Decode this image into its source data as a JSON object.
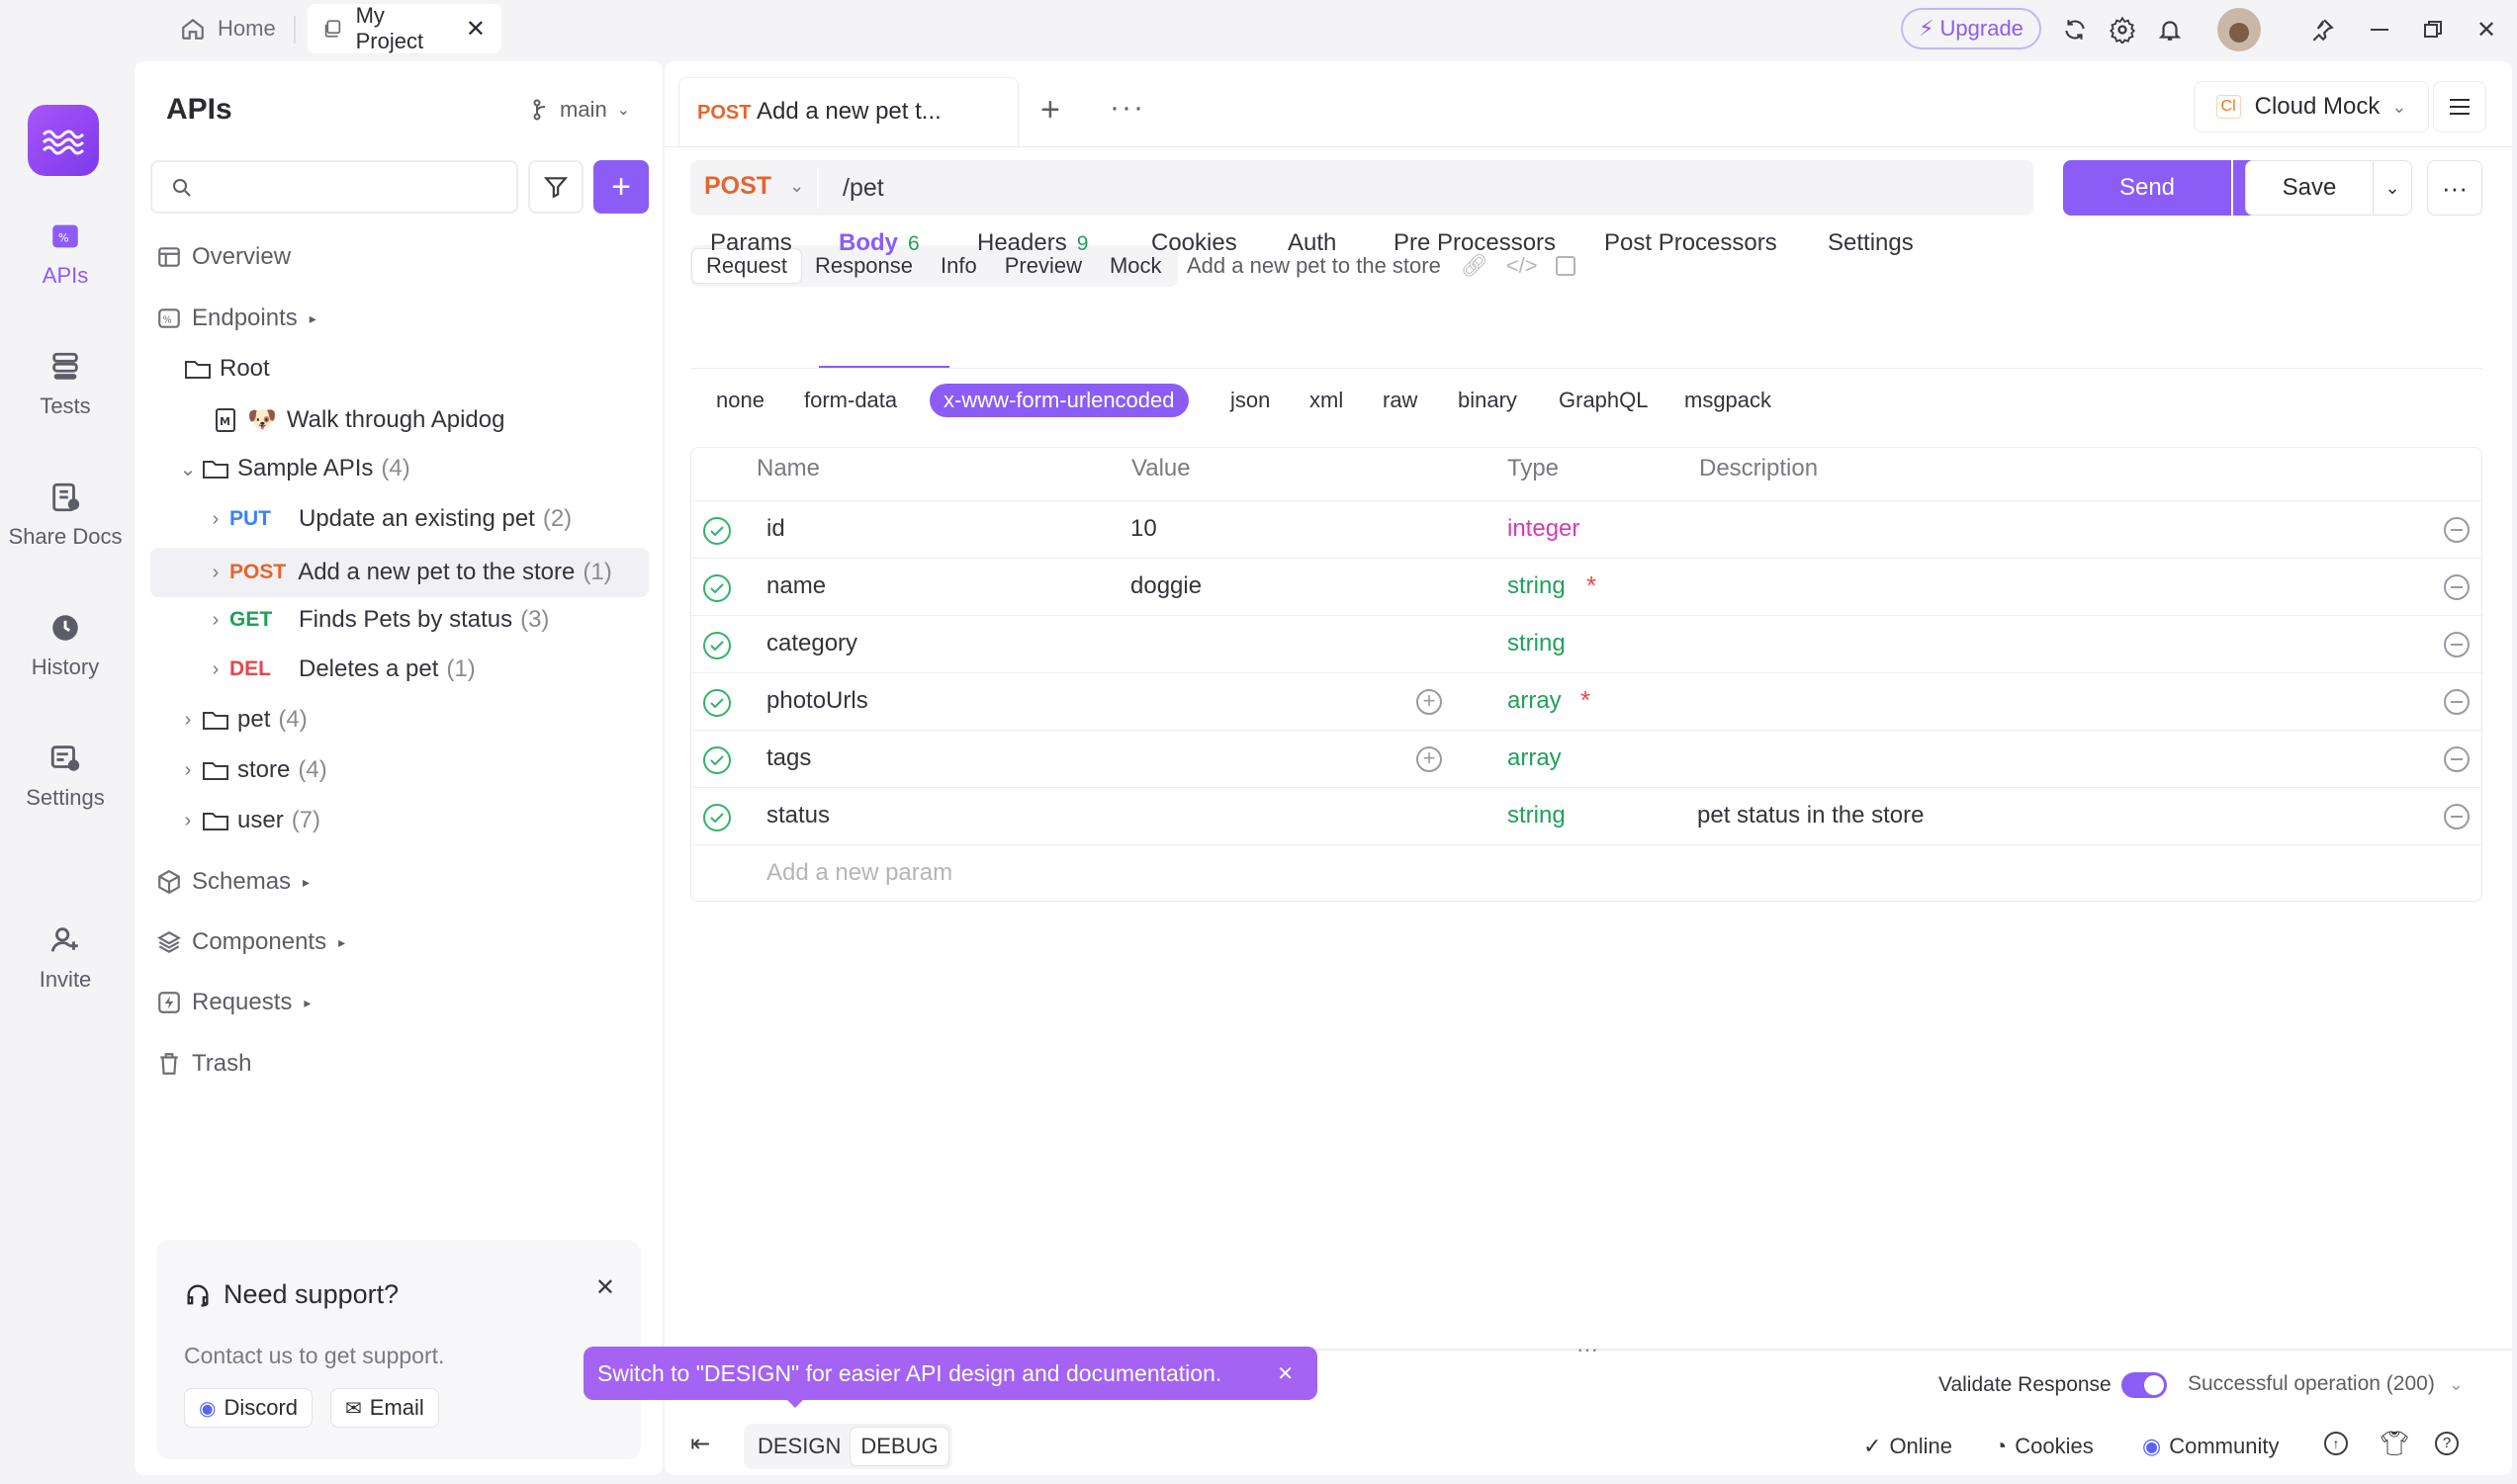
{
  "titlebar": {
    "home_tab": "Home",
    "project_tab": "My Project",
    "upgrade": "Upgrade"
  },
  "rail": {
    "items": [
      {
        "label": "APIs",
        "icon": "apis-icon"
      },
      {
        "label": "Tests",
        "icon": "tests-icon"
      },
      {
        "label": "Share Docs",
        "icon": "share-docs-icon"
      },
      {
        "label": "History",
        "icon": "history-icon"
      },
      {
        "label": "Settings",
        "icon": "settings-icon"
      },
      {
        "label": "Invite",
        "icon": "invite-icon"
      }
    ]
  },
  "leftpanel": {
    "title": "APIs",
    "branch": "main",
    "overview": "Overview",
    "endpoints": "Endpoints",
    "root": "Root",
    "walkthrough": "Walk through Apidog",
    "sample_apis": {
      "label": "Sample APIs",
      "count": "(4)"
    },
    "endpoint_items": [
      {
        "method": "PUT",
        "label": "Update an existing pet",
        "count": "(2)"
      },
      {
        "method": "POST",
        "label": "Add a new pet to the store",
        "count": "(1)"
      },
      {
        "method": "GET",
        "label": "Finds Pets by status",
        "count": "(3)"
      },
      {
        "method": "DEL",
        "label": "Deletes a pet",
        "count": "(1)"
      }
    ],
    "folders": [
      {
        "label": "pet",
        "count": "(4)"
      },
      {
        "label": "store",
        "count": "(4)"
      },
      {
        "label": "user",
        "count": "(7)"
      }
    ],
    "schemas": "Schemas",
    "components": "Components",
    "requests": "Requests",
    "trash": "Trash",
    "support": {
      "title": "Need support?",
      "text": "Contact us to get support.",
      "discord": "Discord",
      "email": "Email"
    }
  },
  "main": {
    "tab": {
      "method": "POST",
      "title": "Add a new pet t..."
    },
    "env": "Cloud Mock",
    "request": {
      "method": "POST",
      "path": "/pet"
    },
    "send": "Send",
    "save": "Save",
    "view_tabs": [
      "Request",
      "Response",
      "Info",
      "Preview",
      "Mock"
    ],
    "endpoint_name": "Add a new pet to the store",
    "sub_tabs": [
      {
        "label": "Params",
        "badge": ""
      },
      {
        "label": "Body",
        "badge": "6"
      },
      {
        "label": "Headers",
        "badge": "9"
      },
      {
        "label": "Cookies",
        "badge": ""
      },
      {
        "label": "Auth",
        "badge": ""
      },
      {
        "label": "Pre Processors",
        "badge": ""
      },
      {
        "label": "Post Processors",
        "badge": ""
      },
      {
        "label": "Settings",
        "badge": ""
      }
    ],
    "body_types": [
      "none",
      "form-data",
      "x-www-form-urlencoded",
      "json",
      "xml",
      "raw",
      "binary",
      "GraphQL",
      "msgpack"
    ],
    "table": {
      "headers": [
        "Name",
        "Value",
        "Type",
        "Description"
      ],
      "rows": [
        {
          "name": "id",
          "value": "10",
          "type": "integer",
          "required": "",
          "description": ""
        },
        {
          "name": "name",
          "value": "doggie",
          "type": "string",
          "required": "*",
          "description": ""
        },
        {
          "name": "category",
          "value": "",
          "type": "string",
          "required": "",
          "description": ""
        },
        {
          "name": "photoUrls",
          "value": "",
          "type": "array",
          "required": "*",
          "description": ""
        },
        {
          "name": "tags",
          "value": "",
          "type": "array",
          "required": "",
          "description": ""
        },
        {
          "name": "status",
          "value": "",
          "type": "string",
          "required": "",
          "description": "pet status in the store"
        }
      ],
      "add_placeholder": "Add a new param"
    },
    "toast": "Switch to \"DESIGN\" for easier API design and documentation.",
    "validate_response": "Validate Response",
    "response_status": "Successful operation (200)",
    "mode_design": "DESIGN",
    "mode_debug": "DEBUG",
    "footer": {
      "online": "Online",
      "cookies": "Cookies",
      "community": "Community"
    }
  },
  "colors": {
    "accent": "#8b5cf6",
    "post": "#e8642c",
    "put": "#3b82f6",
    "get": "#20a05a",
    "del": "#e5484d"
  }
}
